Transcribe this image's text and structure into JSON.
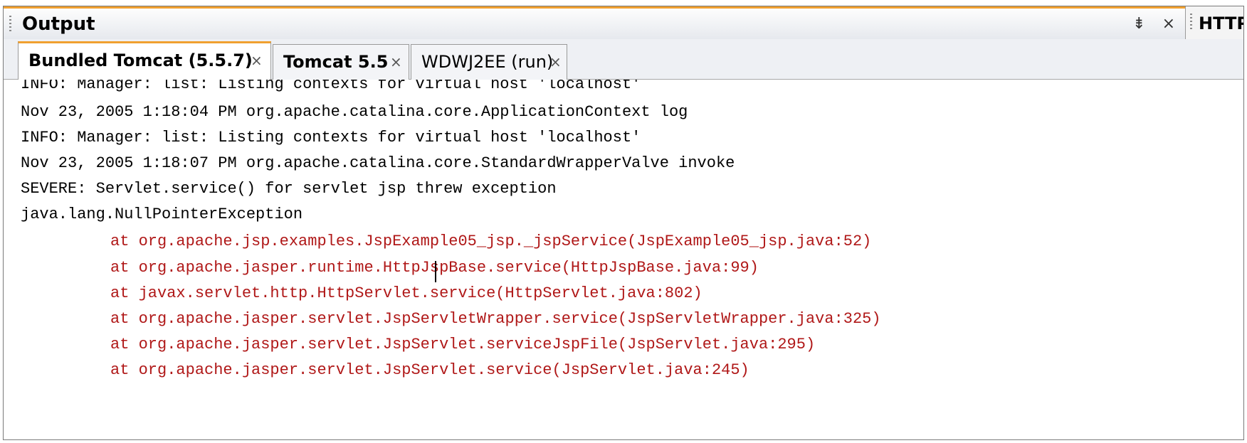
{
  "window": {
    "title": "Output",
    "title_controls": [
      "⇟",
      "×"
    ],
    "side_tab_label": "HTTP"
  },
  "tabs": [
    {
      "label": "Bundled Tomcat (5.5.7)",
      "close": "×",
      "active": true
    },
    {
      "label": "Tomcat 5.5",
      "close": "×",
      "active": false
    },
    {
      "label": "WDWJ2EE (run)",
      "close": "×",
      "active": false
    }
  ],
  "console": {
    "lines": [
      {
        "text": "INFO: Manager: list: Listing contexts for virtual host 'localhost'",
        "type": "normal"
      },
      {
        "text": "Nov 23, 2005 1:18:04 PM org.apache.catalina.core.ApplicationContext log",
        "type": "normal"
      },
      {
        "text": "INFO: Manager: list: Listing contexts for virtual host 'localhost'",
        "type": "normal"
      },
      {
        "text": "Nov 23, 2005 1:18:07 PM org.apache.catalina.core.StandardWrapperValve invoke",
        "type": "normal"
      },
      {
        "text": "SEVERE: Servlet.service() for servlet jsp threw exception",
        "type": "normal"
      },
      {
        "text": "java.lang.NullPointerException",
        "type": "normal"
      },
      {
        "text": "at org.apache.jsp.examples.JspExample05_jsp._jspService(JspExample05_jsp.java:52)",
        "type": "error"
      },
      {
        "text": "at org.apache.jasper.runtime.HttpJspBase.service(HttpJspBase.java:99)",
        "type": "error"
      },
      {
        "text": "at javax.servlet.http.HttpServlet.service(HttpServlet.java:802)",
        "type": "error"
      },
      {
        "text": "at org.apache.jasper.servlet.JspServletWrapper.service(JspServletWrapper.java:325)",
        "type": "error"
      },
      {
        "text": "at org.apache.jasper.servlet.JspServlet.serviceJspFile(JspServlet.java:295)",
        "type": "error"
      },
      {
        "text": "at org.apache.jasper.servlet.JspServlet.service(JspServlet.java:245)",
        "type": "error"
      }
    ]
  },
  "colors": {
    "accent": "#f0a030",
    "error_text": "#b01818",
    "normal_text": "#000000"
  }
}
